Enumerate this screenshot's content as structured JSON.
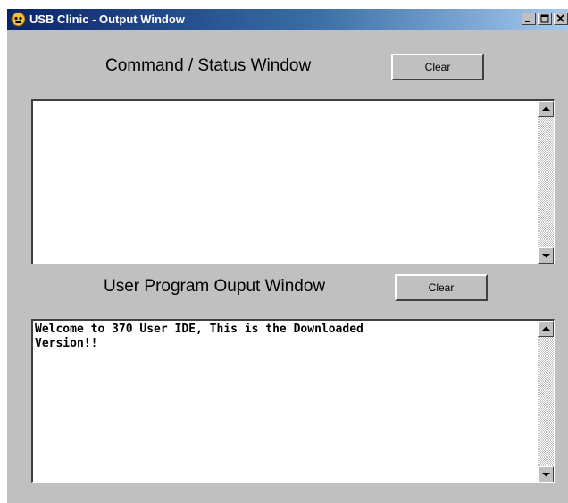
{
  "window": {
    "title": "USB Clinic - Output Window",
    "app_icon": "skull-globe-icon",
    "controls": [
      "minimize-icon",
      "maximize-icon",
      "close-icon"
    ]
  },
  "command_section": {
    "label": "Command / Status Window",
    "clear_label": "Clear",
    "text": ""
  },
  "user_section": {
    "label": "User Program Ouput Window",
    "clear_label": "Clear",
    "text": "Welcome to 370 User IDE, This is the Downloaded\nVersion!!"
  },
  "colors": {
    "window_bg": "#c0c0c0",
    "title_gradient_start": "#0a246a",
    "title_gradient_end": "#a6caf0",
    "textbox_bg": "#ffffff"
  }
}
